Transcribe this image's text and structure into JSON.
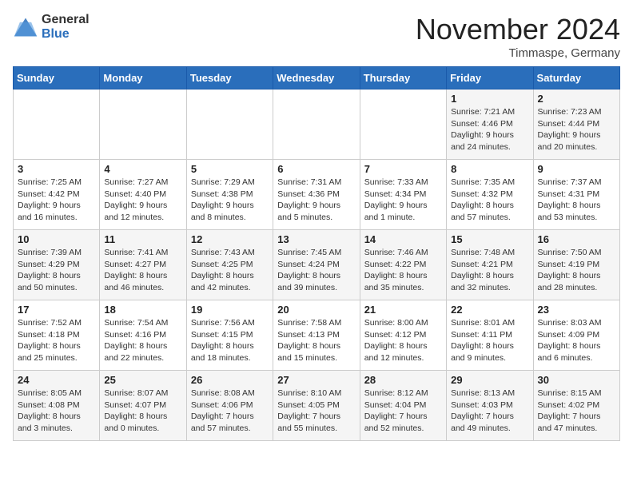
{
  "header": {
    "logo_general": "General",
    "logo_blue": "Blue",
    "month_title": "November 2024",
    "subtitle": "Timmaspe, Germany"
  },
  "days_of_week": [
    "Sunday",
    "Monday",
    "Tuesday",
    "Wednesday",
    "Thursday",
    "Friday",
    "Saturday"
  ],
  "weeks": [
    [
      {
        "day": "",
        "info": ""
      },
      {
        "day": "",
        "info": ""
      },
      {
        "day": "",
        "info": ""
      },
      {
        "day": "",
        "info": ""
      },
      {
        "day": "",
        "info": ""
      },
      {
        "day": "1",
        "info": "Sunrise: 7:21 AM\nSunset: 4:46 PM\nDaylight: 9 hours and 24 minutes."
      },
      {
        "day": "2",
        "info": "Sunrise: 7:23 AM\nSunset: 4:44 PM\nDaylight: 9 hours and 20 minutes."
      }
    ],
    [
      {
        "day": "3",
        "info": "Sunrise: 7:25 AM\nSunset: 4:42 PM\nDaylight: 9 hours and 16 minutes."
      },
      {
        "day": "4",
        "info": "Sunrise: 7:27 AM\nSunset: 4:40 PM\nDaylight: 9 hours and 12 minutes."
      },
      {
        "day": "5",
        "info": "Sunrise: 7:29 AM\nSunset: 4:38 PM\nDaylight: 9 hours and 8 minutes."
      },
      {
        "day": "6",
        "info": "Sunrise: 7:31 AM\nSunset: 4:36 PM\nDaylight: 9 hours and 5 minutes."
      },
      {
        "day": "7",
        "info": "Sunrise: 7:33 AM\nSunset: 4:34 PM\nDaylight: 9 hours and 1 minute."
      },
      {
        "day": "8",
        "info": "Sunrise: 7:35 AM\nSunset: 4:32 PM\nDaylight: 8 hours and 57 minutes."
      },
      {
        "day": "9",
        "info": "Sunrise: 7:37 AM\nSunset: 4:31 PM\nDaylight: 8 hours and 53 minutes."
      }
    ],
    [
      {
        "day": "10",
        "info": "Sunrise: 7:39 AM\nSunset: 4:29 PM\nDaylight: 8 hours and 50 minutes."
      },
      {
        "day": "11",
        "info": "Sunrise: 7:41 AM\nSunset: 4:27 PM\nDaylight: 8 hours and 46 minutes."
      },
      {
        "day": "12",
        "info": "Sunrise: 7:43 AM\nSunset: 4:25 PM\nDaylight: 8 hours and 42 minutes."
      },
      {
        "day": "13",
        "info": "Sunrise: 7:45 AM\nSunset: 4:24 PM\nDaylight: 8 hours and 39 minutes."
      },
      {
        "day": "14",
        "info": "Sunrise: 7:46 AM\nSunset: 4:22 PM\nDaylight: 8 hours and 35 minutes."
      },
      {
        "day": "15",
        "info": "Sunrise: 7:48 AM\nSunset: 4:21 PM\nDaylight: 8 hours and 32 minutes."
      },
      {
        "day": "16",
        "info": "Sunrise: 7:50 AM\nSunset: 4:19 PM\nDaylight: 8 hours and 28 minutes."
      }
    ],
    [
      {
        "day": "17",
        "info": "Sunrise: 7:52 AM\nSunset: 4:18 PM\nDaylight: 8 hours and 25 minutes."
      },
      {
        "day": "18",
        "info": "Sunrise: 7:54 AM\nSunset: 4:16 PM\nDaylight: 8 hours and 22 minutes."
      },
      {
        "day": "19",
        "info": "Sunrise: 7:56 AM\nSunset: 4:15 PM\nDaylight: 8 hours and 18 minutes."
      },
      {
        "day": "20",
        "info": "Sunrise: 7:58 AM\nSunset: 4:13 PM\nDaylight: 8 hours and 15 minutes."
      },
      {
        "day": "21",
        "info": "Sunrise: 8:00 AM\nSunset: 4:12 PM\nDaylight: 8 hours and 12 minutes."
      },
      {
        "day": "22",
        "info": "Sunrise: 8:01 AM\nSunset: 4:11 PM\nDaylight: 8 hours and 9 minutes."
      },
      {
        "day": "23",
        "info": "Sunrise: 8:03 AM\nSunset: 4:09 PM\nDaylight: 8 hours and 6 minutes."
      }
    ],
    [
      {
        "day": "24",
        "info": "Sunrise: 8:05 AM\nSunset: 4:08 PM\nDaylight: 8 hours and 3 minutes."
      },
      {
        "day": "25",
        "info": "Sunrise: 8:07 AM\nSunset: 4:07 PM\nDaylight: 8 hours and 0 minutes."
      },
      {
        "day": "26",
        "info": "Sunrise: 8:08 AM\nSunset: 4:06 PM\nDaylight: 7 hours and 57 minutes."
      },
      {
        "day": "27",
        "info": "Sunrise: 8:10 AM\nSunset: 4:05 PM\nDaylight: 7 hours and 55 minutes."
      },
      {
        "day": "28",
        "info": "Sunrise: 8:12 AM\nSunset: 4:04 PM\nDaylight: 7 hours and 52 minutes."
      },
      {
        "day": "29",
        "info": "Sunrise: 8:13 AM\nSunset: 4:03 PM\nDaylight: 7 hours and 49 minutes."
      },
      {
        "day": "30",
        "info": "Sunrise: 8:15 AM\nSunset: 4:02 PM\nDaylight: 7 hours and 47 minutes."
      }
    ]
  ]
}
